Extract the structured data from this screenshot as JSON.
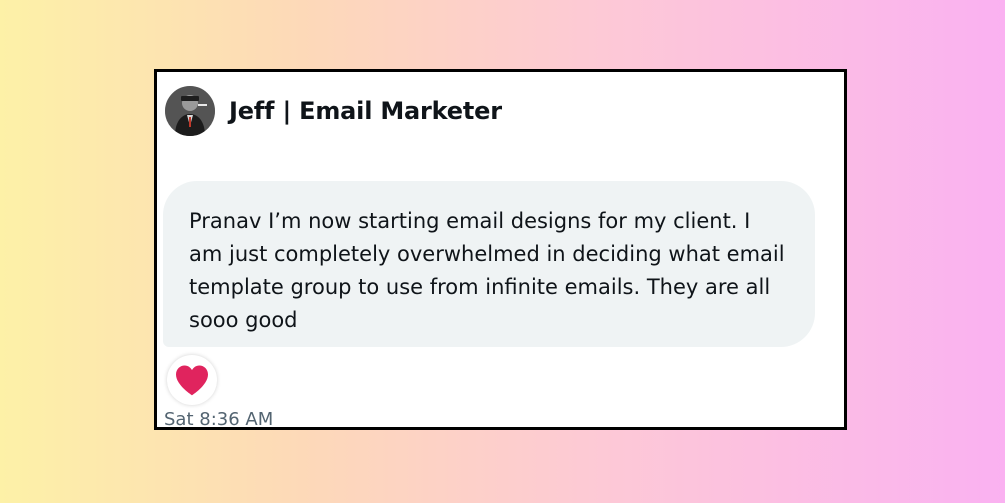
{
  "message_card": {
    "sender_name": "Jeff | Email Marketer",
    "avatar_icon": "profile-photo-avatar",
    "message_text": "Pranav I’m now starting email designs for my client. I am just completely overwhelmed in deciding what email template group to use from infinite emails. They are all sooo good",
    "reaction_icon": "heart-icon",
    "reaction_color": "#e0245e",
    "timestamp": "Sat 8:36 AM",
    "bubble_color": "#eff3f4"
  },
  "background": {
    "gradient_colors": [
      "#fdf1a7",
      "#fdd9b8",
      "#fdc9d6",
      "#fab1f1"
    ]
  }
}
